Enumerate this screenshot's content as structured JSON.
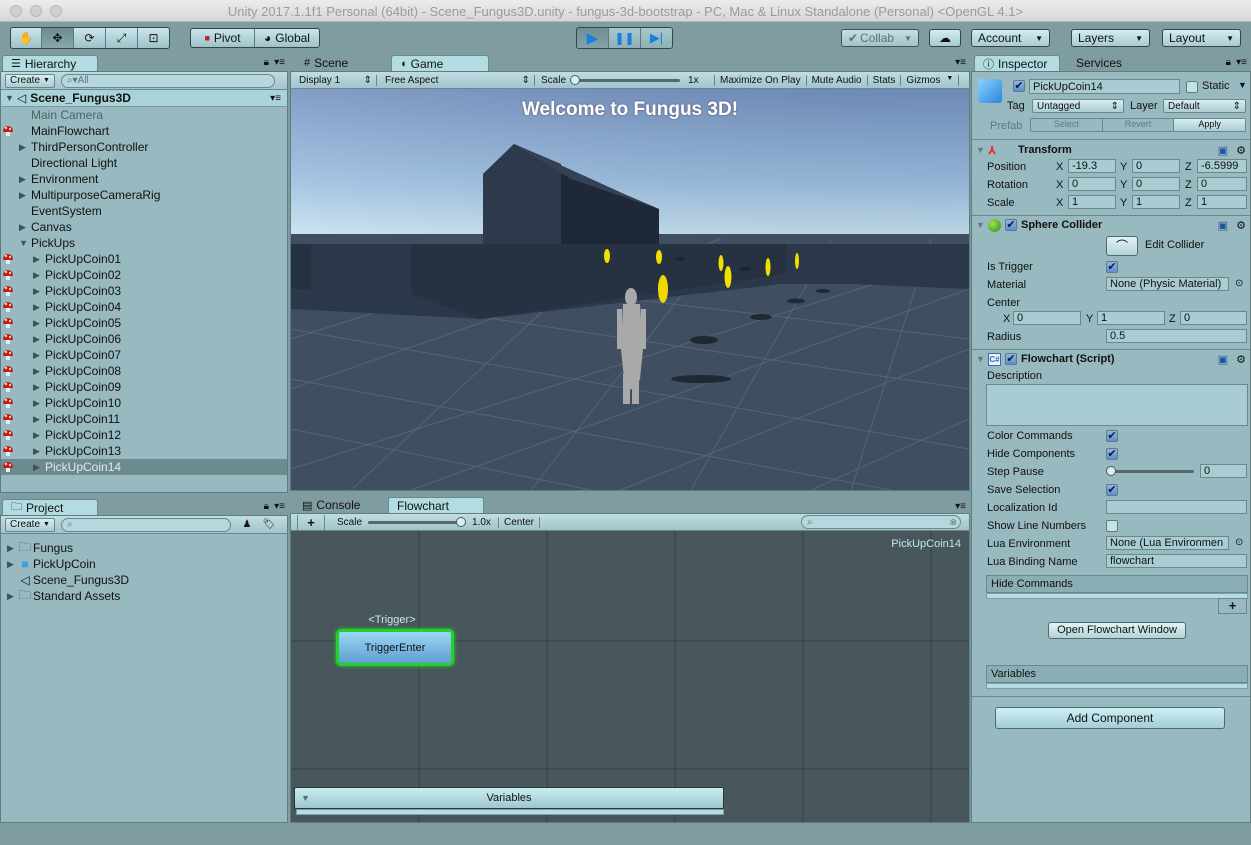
{
  "window": {
    "title": "Unity 2017.1.1f1 Personal (64bit) - Scene_Fungus3D.unity - fungus-3d-bootstrap - PC, Mac & Linux Standalone (Personal) <OpenGL 4.1>"
  },
  "toolbar": {
    "transform_tools": [
      "hand-tool",
      "move-tool",
      "rotate-tool",
      "scale-tool",
      "rect-tool"
    ],
    "pivot_label": "Pivot",
    "global_label": "Global",
    "collab_label": "Collab",
    "account_label": "Account",
    "layers_label": "Layers",
    "layout_label": "Layout"
  },
  "hierarchy": {
    "tab_label": "Hierarchy",
    "create_label": "Create",
    "search_placeholder": "All",
    "scene_name": "Scene_Fungus3D",
    "items": [
      {
        "label": "Main Camera",
        "indent": 0,
        "arrow": "",
        "fungus": false,
        "dim": true
      },
      {
        "label": "MainFlowchart",
        "indent": 0,
        "arrow": "",
        "fungus": true
      },
      {
        "label": "ThirdPersonController",
        "indent": 0,
        "arrow": "right",
        "fungus": false
      },
      {
        "label": "Directional Light",
        "indent": 0,
        "arrow": "",
        "fungus": false
      },
      {
        "label": "Environment",
        "indent": 0,
        "arrow": "right",
        "fungus": false
      },
      {
        "label": "MultipurposeCameraRig",
        "indent": 0,
        "arrow": "right",
        "fungus": false
      },
      {
        "label": "EventSystem",
        "indent": 0,
        "arrow": "",
        "fungus": false
      },
      {
        "label": "Canvas",
        "indent": 0,
        "arrow": "right",
        "fungus": false
      },
      {
        "label": "PickUps",
        "indent": 0,
        "arrow": "down",
        "fungus": false
      },
      {
        "label": "PickUpCoin01",
        "indent": 1,
        "arrow": "right",
        "fungus": true
      },
      {
        "label": "PickUpCoin02",
        "indent": 1,
        "arrow": "right",
        "fungus": true
      },
      {
        "label": "PickUpCoin03",
        "indent": 1,
        "arrow": "right",
        "fungus": true
      },
      {
        "label": "PickUpCoin04",
        "indent": 1,
        "arrow": "right",
        "fungus": true
      },
      {
        "label": "PickUpCoin05",
        "indent": 1,
        "arrow": "right",
        "fungus": true
      },
      {
        "label": "PickUpCoin06",
        "indent": 1,
        "arrow": "right",
        "fungus": true
      },
      {
        "label": "PickUpCoin07",
        "indent": 1,
        "arrow": "right",
        "fungus": true
      },
      {
        "label": "PickUpCoin08",
        "indent": 1,
        "arrow": "right",
        "fungus": true
      },
      {
        "label": "PickUpCoin09",
        "indent": 1,
        "arrow": "right",
        "fungus": true
      },
      {
        "label": "PickUpCoin10",
        "indent": 1,
        "arrow": "right",
        "fungus": true
      },
      {
        "label": "PickUpCoin11",
        "indent": 1,
        "arrow": "right",
        "fungus": true
      },
      {
        "label": "PickUpCoin12",
        "indent": 1,
        "arrow": "right",
        "fungus": true
      },
      {
        "label": "PickUpCoin13",
        "indent": 1,
        "arrow": "right",
        "fungus": true
      },
      {
        "label": "PickUpCoin14",
        "indent": 1,
        "arrow": "right",
        "fungus": true,
        "selected": true
      }
    ]
  },
  "project": {
    "tab_label": "Project",
    "create_label": "Create",
    "items": [
      {
        "label": "Fungus",
        "icon": "folder",
        "arrow": true
      },
      {
        "label": "PickUpCoin",
        "icon": "prefab",
        "arrow": true
      },
      {
        "label": "Scene_Fungus3D",
        "icon": "unity-scene",
        "arrow": false
      },
      {
        "label": "Standard Assets",
        "icon": "folder",
        "arrow": true
      }
    ]
  },
  "game_view": {
    "tabs": [
      {
        "label": "Scene"
      },
      {
        "label": "Game",
        "active": true
      }
    ],
    "display": "Display 1",
    "aspect": "Free Aspect",
    "scale_label": "Scale",
    "scale_value": "1x",
    "maximize_label": "Maximize On Play",
    "mute_label": "Mute Audio",
    "stats_label": "Stats",
    "gizmos_label": "Gizmos",
    "welcome_text": "Welcome to Fungus 3D!"
  },
  "flowchart_view": {
    "tabs": [
      {
        "label": "Console"
      },
      {
        "label": "Flowchart",
        "active": true
      }
    ],
    "add_label": "+",
    "scale_label": "Scale",
    "scale_value": "1.0x",
    "center_label": "Center",
    "flowchart_name": "PickUpCoin14",
    "block_event": "<Trigger>",
    "block_name": "TriggerEnter",
    "variables_label": "Variables"
  },
  "inspector": {
    "tabs": [
      {
        "label": "Inspector",
        "active": true
      },
      {
        "label": "Services"
      }
    ],
    "object_name": "PickUpCoin14",
    "active": true,
    "static_label": "Static",
    "static": false,
    "tag_label": "Tag",
    "tag_value": "Untagged",
    "layer_label": "Layer",
    "layer_value": "Default",
    "prefab_label": "Prefab",
    "prefab_select": "Select",
    "prefab_revert": "Revert",
    "prefab_apply": "Apply",
    "transform": {
      "title": "Transform",
      "rows": [
        {
          "label": "Position",
          "x": "-19.3",
          "y": "0",
          "z": "-6.5999"
        },
        {
          "label": "Rotation",
          "x": "0",
          "y": "0",
          "z": "0"
        },
        {
          "label": "Scale",
          "x": "1",
          "y": "1",
          "z": "1"
        }
      ]
    },
    "sphere_collider": {
      "title": "Sphere Collider",
      "edit_label": "Edit Collider",
      "is_trigger_label": "Is Trigger",
      "is_trigger": true,
      "material_label": "Material",
      "material_value": "None (Physic Material)",
      "center_label": "Center",
      "center": {
        "x": "0",
        "y": "1",
        "z": "0"
      },
      "radius_label": "Radius",
      "radius_value": "0.5"
    },
    "flowchart": {
      "title": "Flowchart (Script)",
      "description_label": "Description",
      "description_value": "",
      "color_commands_label": "Color Commands",
      "color_commands": true,
      "hide_components_label": "Hide Components",
      "hide_components": true,
      "step_pause_label": "Step Pause",
      "step_pause_value": "0",
      "save_selection_label": "Save Selection",
      "save_selection": true,
      "localization_label": "Localization Id",
      "localization_value": "",
      "show_line_numbers_label": "Show Line Numbers",
      "show_line_numbers": false,
      "lua_env_label": "Lua Environment",
      "lua_env_value": "None (Lua Environmen",
      "lua_binding_label": "Lua Binding Name",
      "lua_binding_value": "flowchart",
      "hide_commands_label": "Hide Commands",
      "add_label": "+",
      "open_window_label": "Open Flowchart Window",
      "variables_label": "Variables"
    },
    "add_component_label": "Add Component"
  }
}
